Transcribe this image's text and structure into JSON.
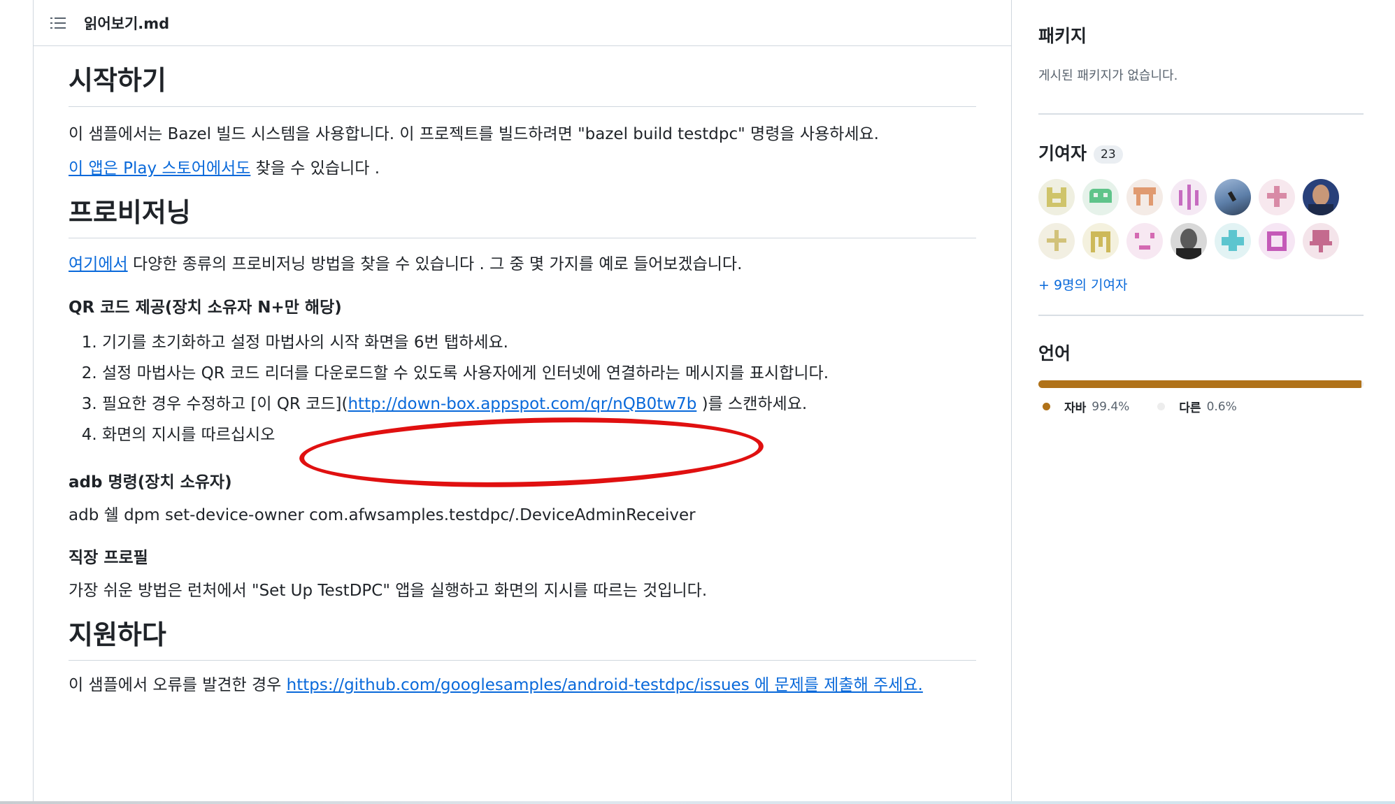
{
  "readme": {
    "file_name": "읽어보기.md",
    "toc_icon": "list-unordered-icon",
    "getting_started": {
      "heading": "시작하기",
      "p1": "이 샘플에서는 Bazel 빌드 시스템을 사용합니다. 이 프로젝트를 빌드하려면 \"bazel build testdpc\" 명령을 사용하세요.",
      "p2_link": "이 앱은 Play 스토어에서도",
      "p2_rest": " 찾을 수 있습니다 ."
    },
    "provisioning": {
      "heading": "프로비저닝",
      "p_link": "여기에서",
      "p_rest": " 다양한 종류의 프로비저닝 방법을 찾을 수 있습니다 . 그 중 몇 가지를 예로 들어보겠습니다.",
      "qr_heading": "QR 코드 제공(장치 소유자 N+만 해당)",
      "steps": [
        "기기를 초기화하고 설정 마법사의 시작 화면을 6번 탭하세요.",
        "설정 마법사는 QR 코드 리더를 다운로드할 수 있도록 사용자에게 인터넷에 연결하라는 메시지를 표시합니다.",
        "필요한 경우 수정하고 [이 QR 코드](",
        "화면의 지시를 따르십시오"
      ],
      "step3_link": "http://down-box.appspot.com/qr/nQB0tw7b",
      "step3_rest": " )를 스캔하세요.",
      "adb_heading": "adb 명령(장치 소유자)",
      "adb_command": "adb 쉘 dpm set-device-owner com.afwsamples.testdpc/.DeviceAdminReceiver",
      "work_heading": "직장 프로필",
      "work_text": "가장 쉬운 방법은 런처에서 \"Set Up TestDPC\" 앱을 실행하고 화면의 지시를 따르는 것입니다."
    },
    "support": {
      "heading": "지원하다",
      "text": "이 샘플에서 오류를 발견한 경우 ",
      "link": "https://github.com/googlesamples/android-testdpc/issues 에 문제를 제출해 주세요."
    }
  },
  "sidebar": {
    "packages_title": "패키지",
    "packages_empty": "게시된 패키지가 없습니다.",
    "contributors_title": "기여자",
    "contributors_count": "23",
    "more_contributors": "+ 9명의 기여자",
    "languages_title": "언어",
    "languages": [
      {
        "name": "자바",
        "percent": "99.4%",
        "value": 99.4,
        "color": "#b07219"
      },
      {
        "name": "다른",
        "percent": "0.6%",
        "value": 0.6,
        "color": "#ededed"
      }
    ]
  }
}
